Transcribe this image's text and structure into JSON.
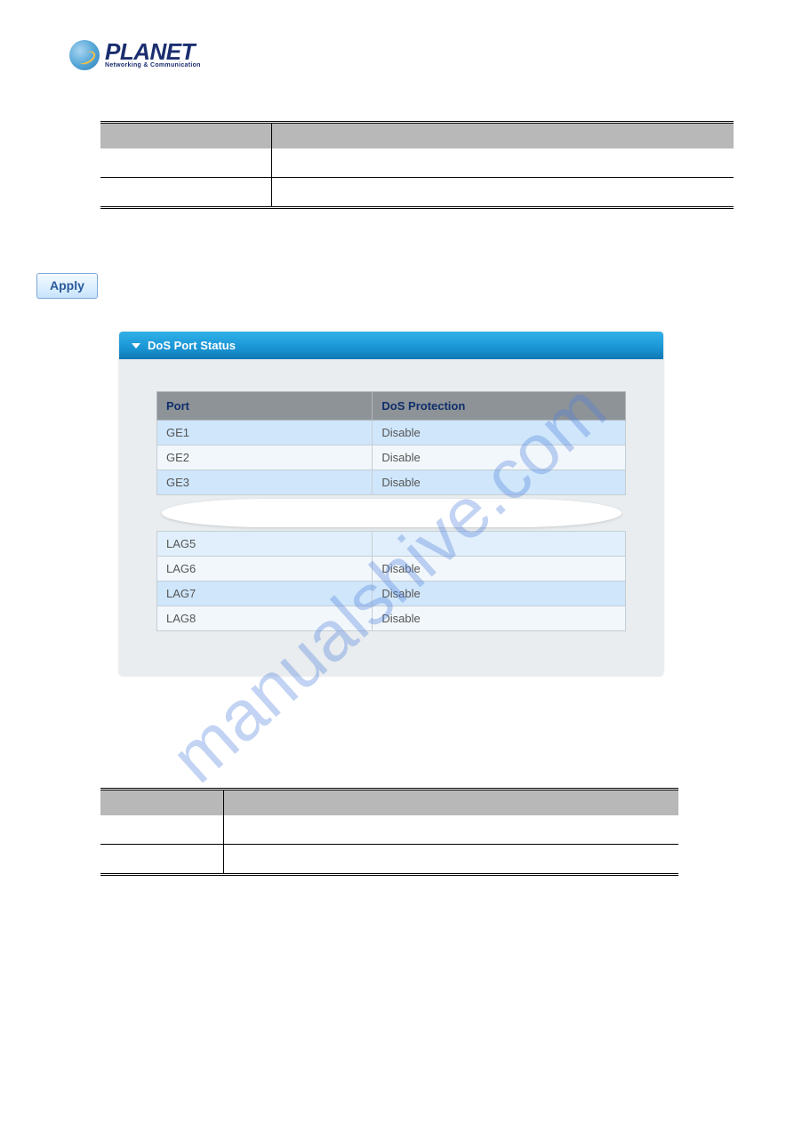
{
  "logo": {
    "main": "PLANET",
    "sub": "Networking & Communication"
  },
  "apply_button": "Apply",
  "panel": {
    "title": "DoS Port Status",
    "headers": {
      "port": "Port",
      "protection": "DoS Protection"
    },
    "rows_top": [
      {
        "port": "GE1",
        "protection": "Disable"
      },
      {
        "port": "GE2",
        "protection": "Disable"
      },
      {
        "port": "GE3",
        "protection": "Disable"
      }
    ],
    "rows_bottom": [
      {
        "port": "LAG5",
        "protection": ""
      },
      {
        "port": "LAG6",
        "protection": "Disable"
      },
      {
        "port": "LAG7",
        "protection": "Disable"
      },
      {
        "port": "LAG8",
        "protection": "Disable"
      }
    ]
  },
  "watermark": "manualshive.com"
}
